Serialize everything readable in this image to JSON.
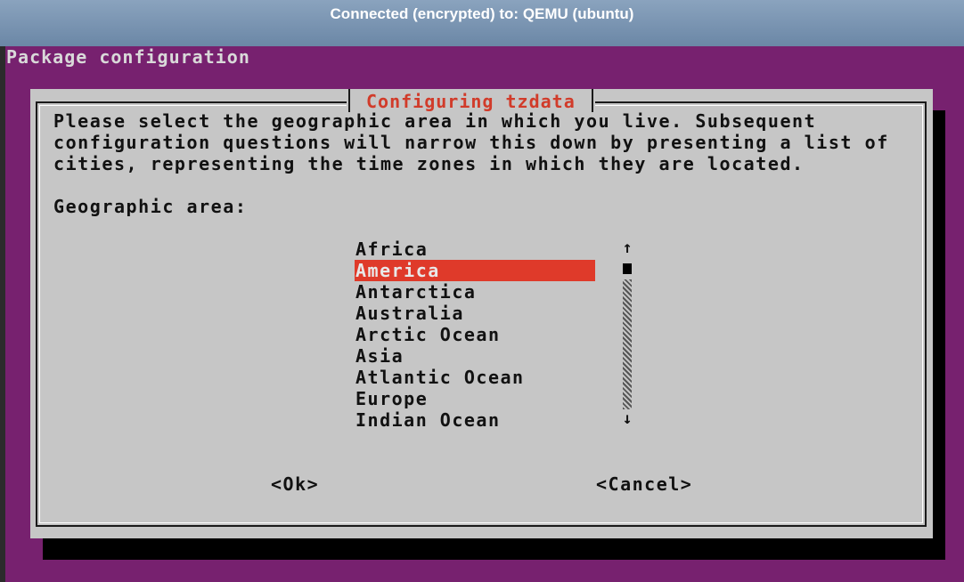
{
  "window": {
    "title": "Connected (encrypted) to: QEMU (ubuntu)"
  },
  "screen": {
    "title": "Package configuration"
  },
  "dialog": {
    "title": "Configuring tzdata",
    "description_lines": [
      "Please select the geographic area in which you live. Subsequent",
      "configuration questions will narrow this down by presenting a list of",
      "cities, representing the time zones in which they are located."
    ],
    "prompt": "Geographic area:",
    "areas": [
      "Africa",
      "America",
      "Antarctica",
      "Australia",
      "Arctic Ocean",
      "Asia",
      "Atlantic Ocean",
      "Europe",
      "Indian Ocean"
    ],
    "selected": "America",
    "ok_label": "<Ok>",
    "cancel_label": "<Cancel>"
  },
  "colors": {
    "background": "#77216f",
    "dialog": "#c6c6c6",
    "accent": "#df3a2a"
  },
  "icons": {
    "scroll_up": "up-arrow-icon",
    "scroll_down": "down-arrow-icon"
  }
}
